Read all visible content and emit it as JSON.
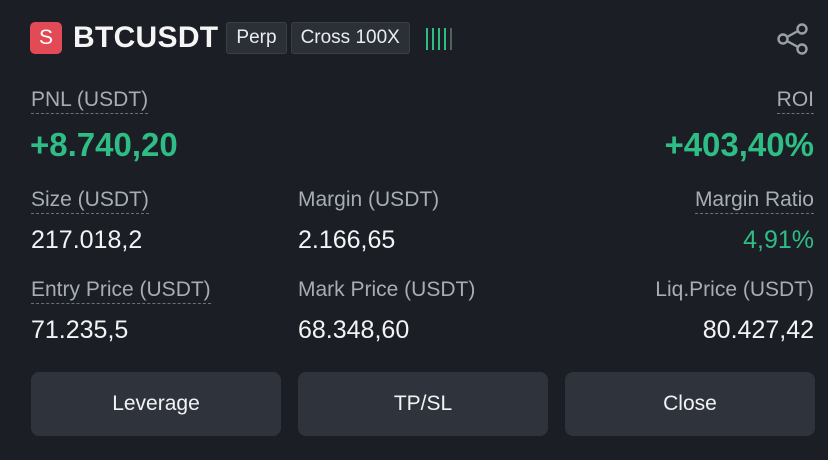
{
  "header": {
    "side_badge": "S",
    "symbol": "BTCUSDT",
    "contract_type": "Perp",
    "margin_mode": "Cross 100X",
    "share_icon": "share-icon"
  },
  "pnl": {
    "label": "PNL (USDT)",
    "value": "+8.740,20"
  },
  "roi": {
    "label": "ROI",
    "value": "+403,40%"
  },
  "size": {
    "label": "Size (USDT)",
    "value": "217.018,2"
  },
  "margin": {
    "label": "Margin (USDT)",
    "value": "2.166,65"
  },
  "margin_ratio": {
    "label": "Margin Ratio",
    "value": "4,91%"
  },
  "entry_price": {
    "label": "Entry Price (USDT)",
    "value": "71.235,5"
  },
  "mark_price": {
    "label": "Mark Price (USDT)",
    "value": "68.348,60"
  },
  "liq_price": {
    "label": "Liq.Price (USDT)",
    "value": "80.427,42"
  },
  "actions": {
    "leverage": "Leverage",
    "tpsl": "TP/SL",
    "close": "Close"
  },
  "colors": {
    "profit": "#2ebd85",
    "short": "#e24a56",
    "background": "#1b1e24",
    "button": "#2f343c"
  }
}
